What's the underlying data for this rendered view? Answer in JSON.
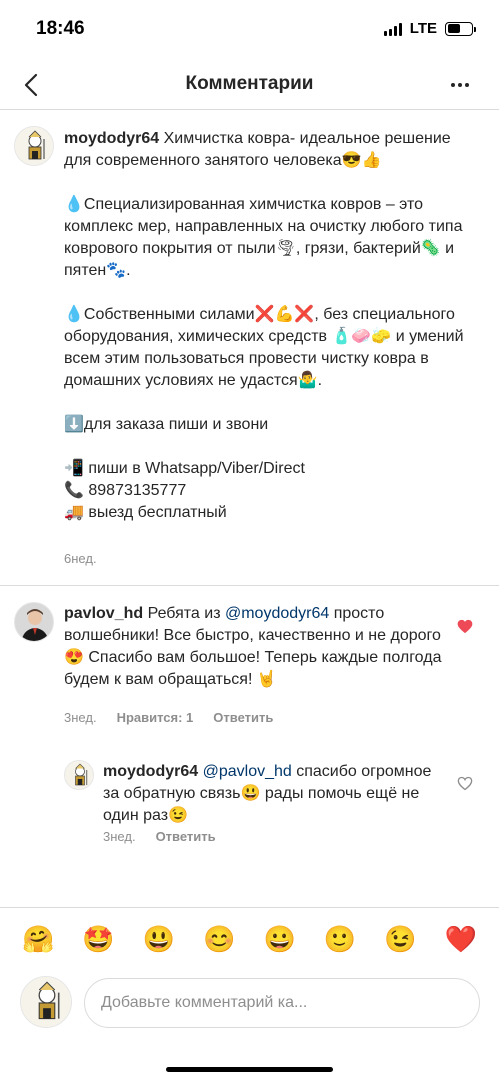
{
  "status_bar": {
    "time": "18:46",
    "carrier": "LTE"
  },
  "nav": {
    "title": "Комментарии"
  },
  "post": {
    "username": "moydodyr64",
    "paragraphs": [
      "Химчистка ковра- идеальное решение для современного занятого человека😎👍",
      "",
      "💧Специализированная химчистка ковров – это комплекс мер, направленных на очистку любого типа коврового покрытия от пыли🌪, грязи, бактерий🦠 и пятен🐾.",
      "",
      "💧Собственными силами❌💪❌, без специального оборудования, химических средств 🧴🧼🧽 и умений всем этим пользоваться провести чистку ковра в домашних условиях не удастся🤷‍♂️.",
      "",
      "⬇️для заказа пиши и звони",
      "",
      "📲 пиши в Whatsapp/Viber/Direct",
      "📞 89873135777",
      "🚚 выезд бесплатный"
    ],
    "time": "6нед."
  },
  "comment": {
    "username": "pavlov_hd",
    "text_before": "Ребята из ",
    "mention": "@moydodyr64",
    "text_after": "  просто волшебники! Все быстро, качественно и не дорого😍 Спасибо вам большое! Теперь каждые полгода будем к вам обращаться! 🤘",
    "time": "3нед.",
    "likes": "Нравится: 1",
    "reply_label": "Ответить",
    "liked": true
  },
  "reply": {
    "username": "moydodyr64",
    "mention": "@pavlov_hd",
    "text_after": " спасибо огромное за обратную связь😃 рады помочь ещё не один раз😉",
    "time": "3нед.",
    "reply_label": "Ответить",
    "liked": false
  },
  "emoji_bar": [
    "🤗",
    "🤩",
    "😃",
    "😊",
    "😀",
    "🙂",
    "😉",
    "❤️"
  ],
  "composer": {
    "placeholder": "Добавьте комментарий ка..."
  },
  "colors": {
    "like_red": "#ed4956",
    "mention": "#00376b",
    "meta_gray": "#8e8e8e"
  }
}
